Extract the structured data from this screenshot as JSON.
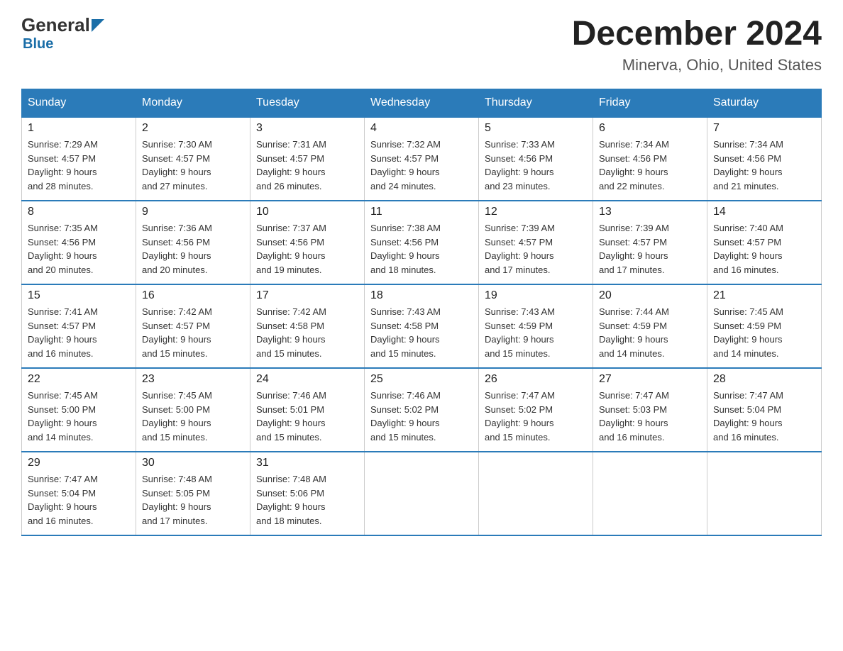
{
  "header": {
    "logo": {
      "general": "General",
      "blue": "Blue"
    },
    "month_title": "December 2024",
    "location": "Minerva, Ohio, United States"
  },
  "weekdays": [
    "Sunday",
    "Monday",
    "Tuesday",
    "Wednesday",
    "Thursday",
    "Friday",
    "Saturday"
  ],
  "weeks": [
    [
      {
        "day": "1",
        "sunrise": "Sunrise: 7:29 AM",
        "sunset": "Sunset: 4:57 PM",
        "daylight": "Daylight: 9 hours",
        "daylight2": "and 28 minutes."
      },
      {
        "day": "2",
        "sunrise": "Sunrise: 7:30 AM",
        "sunset": "Sunset: 4:57 PM",
        "daylight": "Daylight: 9 hours",
        "daylight2": "and 27 minutes."
      },
      {
        "day": "3",
        "sunrise": "Sunrise: 7:31 AM",
        "sunset": "Sunset: 4:57 PM",
        "daylight": "Daylight: 9 hours",
        "daylight2": "and 26 minutes."
      },
      {
        "day": "4",
        "sunrise": "Sunrise: 7:32 AM",
        "sunset": "Sunset: 4:57 PM",
        "daylight": "Daylight: 9 hours",
        "daylight2": "and 24 minutes."
      },
      {
        "day": "5",
        "sunrise": "Sunrise: 7:33 AM",
        "sunset": "Sunset: 4:56 PM",
        "daylight": "Daylight: 9 hours",
        "daylight2": "and 23 minutes."
      },
      {
        "day": "6",
        "sunrise": "Sunrise: 7:34 AM",
        "sunset": "Sunset: 4:56 PM",
        "daylight": "Daylight: 9 hours",
        "daylight2": "and 22 minutes."
      },
      {
        "day": "7",
        "sunrise": "Sunrise: 7:34 AM",
        "sunset": "Sunset: 4:56 PM",
        "daylight": "Daylight: 9 hours",
        "daylight2": "and 21 minutes."
      }
    ],
    [
      {
        "day": "8",
        "sunrise": "Sunrise: 7:35 AM",
        "sunset": "Sunset: 4:56 PM",
        "daylight": "Daylight: 9 hours",
        "daylight2": "and 20 minutes."
      },
      {
        "day": "9",
        "sunrise": "Sunrise: 7:36 AM",
        "sunset": "Sunset: 4:56 PM",
        "daylight": "Daylight: 9 hours",
        "daylight2": "and 20 minutes."
      },
      {
        "day": "10",
        "sunrise": "Sunrise: 7:37 AM",
        "sunset": "Sunset: 4:56 PM",
        "daylight": "Daylight: 9 hours",
        "daylight2": "and 19 minutes."
      },
      {
        "day": "11",
        "sunrise": "Sunrise: 7:38 AM",
        "sunset": "Sunset: 4:56 PM",
        "daylight": "Daylight: 9 hours",
        "daylight2": "and 18 minutes."
      },
      {
        "day": "12",
        "sunrise": "Sunrise: 7:39 AM",
        "sunset": "Sunset: 4:57 PM",
        "daylight": "Daylight: 9 hours",
        "daylight2": "and 17 minutes."
      },
      {
        "day": "13",
        "sunrise": "Sunrise: 7:39 AM",
        "sunset": "Sunset: 4:57 PM",
        "daylight": "Daylight: 9 hours",
        "daylight2": "and 17 minutes."
      },
      {
        "day": "14",
        "sunrise": "Sunrise: 7:40 AM",
        "sunset": "Sunset: 4:57 PM",
        "daylight": "Daylight: 9 hours",
        "daylight2": "and 16 minutes."
      }
    ],
    [
      {
        "day": "15",
        "sunrise": "Sunrise: 7:41 AM",
        "sunset": "Sunset: 4:57 PM",
        "daylight": "Daylight: 9 hours",
        "daylight2": "and 16 minutes."
      },
      {
        "day": "16",
        "sunrise": "Sunrise: 7:42 AM",
        "sunset": "Sunset: 4:57 PM",
        "daylight": "Daylight: 9 hours",
        "daylight2": "and 15 minutes."
      },
      {
        "day": "17",
        "sunrise": "Sunrise: 7:42 AM",
        "sunset": "Sunset: 4:58 PM",
        "daylight": "Daylight: 9 hours",
        "daylight2": "and 15 minutes."
      },
      {
        "day": "18",
        "sunrise": "Sunrise: 7:43 AM",
        "sunset": "Sunset: 4:58 PM",
        "daylight": "Daylight: 9 hours",
        "daylight2": "and 15 minutes."
      },
      {
        "day": "19",
        "sunrise": "Sunrise: 7:43 AM",
        "sunset": "Sunset: 4:59 PM",
        "daylight": "Daylight: 9 hours",
        "daylight2": "and 15 minutes."
      },
      {
        "day": "20",
        "sunrise": "Sunrise: 7:44 AM",
        "sunset": "Sunset: 4:59 PM",
        "daylight": "Daylight: 9 hours",
        "daylight2": "and 14 minutes."
      },
      {
        "day": "21",
        "sunrise": "Sunrise: 7:45 AM",
        "sunset": "Sunset: 4:59 PM",
        "daylight": "Daylight: 9 hours",
        "daylight2": "and 14 minutes."
      }
    ],
    [
      {
        "day": "22",
        "sunrise": "Sunrise: 7:45 AM",
        "sunset": "Sunset: 5:00 PM",
        "daylight": "Daylight: 9 hours",
        "daylight2": "and 14 minutes."
      },
      {
        "day": "23",
        "sunrise": "Sunrise: 7:45 AM",
        "sunset": "Sunset: 5:00 PM",
        "daylight": "Daylight: 9 hours",
        "daylight2": "and 15 minutes."
      },
      {
        "day": "24",
        "sunrise": "Sunrise: 7:46 AM",
        "sunset": "Sunset: 5:01 PM",
        "daylight": "Daylight: 9 hours",
        "daylight2": "and 15 minutes."
      },
      {
        "day": "25",
        "sunrise": "Sunrise: 7:46 AM",
        "sunset": "Sunset: 5:02 PM",
        "daylight": "Daylight: 9 hours",
        "daylight2": "and 15 minutes."
      },
      {
        "day": "26",
        "sunrise": "Sunrise: 7:47 AM",
        "sunset": "Sunset: 5:02 PM",
        "daylight": "Daylight: 9 hours",
        "daylight2": "and 15 minutes."
      },
      {
        "day": "27",
        "sunrise": "Sunrise: 7:47 AM",
        "sunset": "Sunset: 5:03 PM",
        "daylight": "Daylight: 9 hours",
        "daylight2": "and 16 minutes."
      },
      {
        "day": "28",
        "sunrise": "Sunrise: 7:47 AM",
        "sunset": "Sunset: 5:04 PM",
        "daylight": "Daylight: 9 hours",
        "daylight2": "and 16 minutes."
      }
    ],
    [
      {
        "day": "29",
        "sunrise": "Sunrise: 7:47 AM",
        "sunset": "Sunset: 5:04 PM",
        "daylight": "Daylight: 9 hours",
        "daylight2": "and 16 minutes."
      },
      {
        "day": "30",
        "sunrise": "Sunrise: 7:48 AM",
        "sunset": "Sunset: 5:05 PM",
        "daylight": "Daylight: 9 hours",
        "daylight2": "and 17 minutes."
      },
      {
        "day": "31",
        "sunrise": "Sunrise: 7:48 AM",
        "sunset": "Sunset: 5:06 PM",
        "daylight": "Daylight: 9 hours",
        "daylight2": "and 18 minutes."
      },
      null,
      null,
      null,
      null
    ]
  ]
}
